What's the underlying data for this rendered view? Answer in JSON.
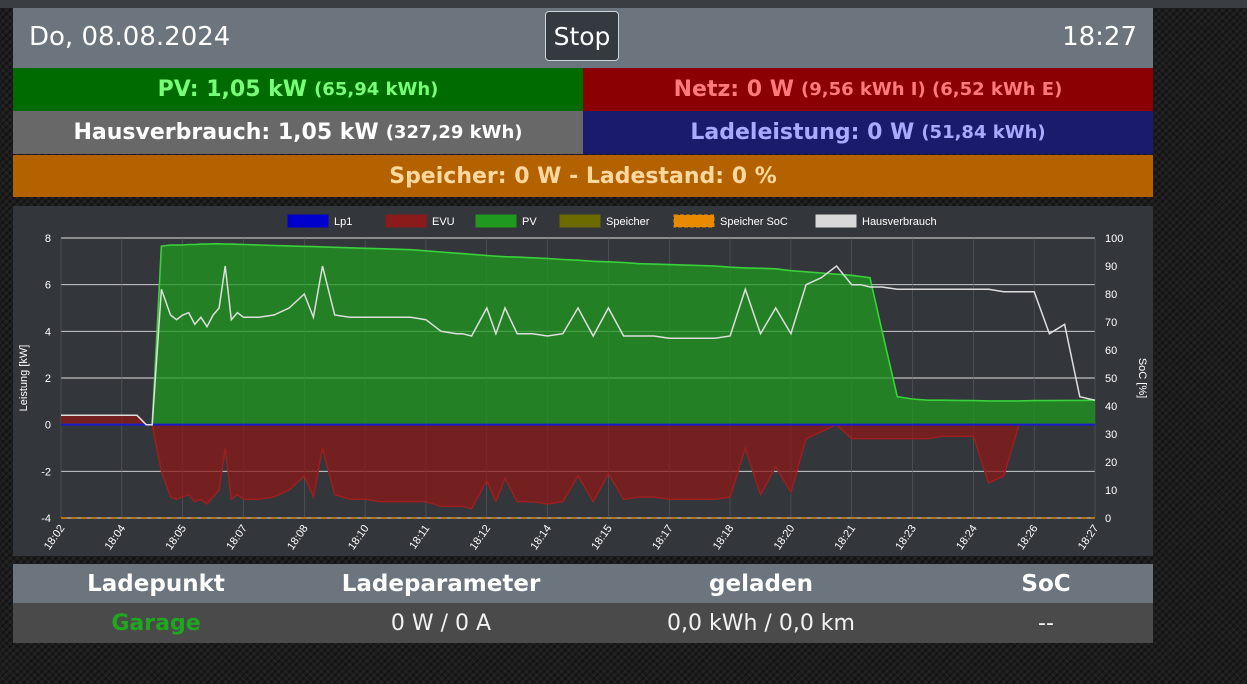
{
  "header": {
    "date": "Do, 08.08.2024",
    "stop_label": "Stop",
    "time": "18:27"
  },
  "status": {
    "pv_main": "PV: 1,05 kW",
    "pv_sub": "(65,94 kWh)",
    "netz_main": "Netz: 0 W",
    "netz_sub": "(9,56 kWh I) (6,52 kWh E)",
    "haus_main": "Hausverbrauch: 1,05 kW",
    "haus_sub": "(327,29 kWh)",
    "lade_main": "Ladeleistung: 0 W",
    "lade_sub": "(51,84 kWh)",
    "speicher": "Speicher: 0 W - Ladestand: 0 %"
  },
  "colors": {
    "pv_bg": "#006b00",
    "netz_bg": "#8b0000",
    "haus_bg": "#686868",
    "lade_bg": "#1b1b6e",
    "speicher_bg": "#b46200",
    "header_bg": "#6c757d"
  },
  "table": {
    "headers": [
      "Ladepunkt",
      "Ladeparameter",
      "geladen",
      "SoC"
    ],
    "row": [
      "Garage",
      "0 W / 0 A",
      "0,0 kWh / 0,0 km",
      "--"
    ]
  },
  "chart_data": {
    "type": "line",
    "ylabel": "Leistung [kW]",
    "y2label": "SoC [%]",
    "ylim": [
      -4,
      8
    ],
    "y2lim": [
      0,
      100
    ],
    "yticks": [
      8,
      6,
      4,
      2,
      0,
      -2,
      -4
    ],
    "y2ticks": [
      100,
      90,
      80,
      70,
      60,
      50,
      40,
      30,
      20,
      10,
      0
    ],
    "x_ticks": [
      "18:02",
      "18:04",
      "18:05",
      "18:07",
      "18:08",
      "18:10",
      "18:11",
      "18:12",
      "18:14",
      "18:15",
      "18:17",
      "18:18",
      "18:20",
      "18:21",
      "18:23",
      "18:24",
      "18:26",
      "18:27"
    ],
    "legend": [
      "Lp1",
      "EVU",
      "PV",
      "Speicher",
      "Speicher SoC",
      "Hausverbrauch"
    ],
    "legend_colors": [
      "#0000cc",
      "#8b1a1a",
      "#1f9a1f",
      "#6b6b00",
      "#e88b00",
      "#d8d8d8"
    ],
    "x": [
      0,
      0.6,
      1.2,
      1.8,
      2.1,
      2.5,
      2.8,
      3.0,
      3.3,
      3.6,
      3.8,
      4.0,
      4.2,
      4.4,
      4.6,
      4.8,
      5.0,
      5.2,
      5.4,
      5.6,
      5.8,
      6.0,
      6.5,
      7.0,
      7.5,
      8.0,
      8.3,
      8.6,
      9.0,
      9.5,
      10.0,
      10.5,
      11.0,
      11.5,
      12.0,
      12.5,
      13.0,
      13.2,
      13.5,
      14.0,
      14.3,
      14.6,
      15.0,
      15.5,
      16.0,
      16.5,
      17.0,
      17.5,
      18.0,
      18.5,
      19.0,
      19.5,
      20.0,
      20.5,
      21.0,
      21.5,
      22.0,
      22.5,
      23.0,
      23.5,
      24.0,
      24.5,
      25.0,
      25.5,
      26.0,
      26.3,
      26.6,
      27.0,
      27.5,
      28.0,
      28.5,
      29.0,
      29.5,
      30.0,
      30.5,
      31.0,
      31.5,
      32.0,
      32.5,
      33.0,
      33.5,
      34.0
    ],
    "pv": [
      0,
      0,
      0,
      0,
      0,
      0,
      0,
      0,
      7.65,
      7.7,
      7.7,
      7.7,
      7.72,
      7.72,
      7.74,
      7.74,
      7.75,
      7.75,
      7.74,
      7.74,
      7.73,
      7.72,
      7.7,
      7.68,
      7.66,
      7.64,
      7.63,
      7.62,
      7.6,
      7.58,
      7.56,
      7.54,
      7.52,
      7.5,
      7.45,
      7.4,
      7.35,
      7.33,
      7.3,
      7.25,
      7.22,
      7.2,
      7.18,
      7.15,
      7.12,
      7.08,
      7.05,
      7.0,
      6.98,
      6.95,
      6.9,
      6.88,
      6.86,
      6.84,
      6.82,
      6.8,
      6.75,
      6.72,
      6.7,
      6.68,
      6.6,
      6.55,
      6.5,
      6.45,
      6.4,
      6.35,
      6.3,
      4.0,
      1.2,
      1.1,
      1.05,
      1.05,
      1.04,
      1.03,
      1.02,
      1.02,
      1.02,
      1.03,
      1.03,
      1.04,
      1.04,
      1.05
    ],
    "haus": [
      0.4,
      0.4,
      0.4,
      0.4,
      0.4,
      0.4,
      0.0,
      0.0,
      5.8,
      4.7,
      4.5,
      4.7,
      4.8,
      4.3,
      4.6,
      4.2,
      4.7,
      5.0,
      6.8,
      4.5,
      4.8,
      4.6,
      4.6,
      4.7,
      5.0,
      5.6,
      4.6,
      6.8,
      4.7,
      4.6,
      4.6,
      4.6,
      4.6,
      4.6,
      4.5,
      4.0,
      3.9,
      3.9,
      3.8,
      5.0,
      3.9,
      5.0,
      3.9,
      3.9,
      3.8,
      3.9,
      5.0,
      3.8,
      5.0,
      3.8,
      3.8,
      3.8,
      3.7,
      3.7,
      3.7,
      3.7,
      3.8,
      5.8,
      3.9,
      5.0,
      3.9,
      6.0,
      6.3,
      6.8,
      6.0,
      6.0,
      5.9,
      5.9,
      5.8,
      5.8,
      5.8,
      5.8,
      5.8,
      5.8,
      5.8,
      5.7,
      5.7,
      5.7,
      3.9,
      4.3,
      1.2,
      1.05
    ],
    "evu": [
      0.4,
      0.4,
      0.4,
      0.4,
      0.4,
      0.4,
      0,
      0,
      -2.0,
      -3.1,
      -3.2,
      -3.1,
      -3.0,
      -3.3,
      -3.2,
      -3.4,
      -3.1,
      -2.8,
      -1.0,
      -3.2,
      -3.0,
      -3.2,
      -3.2,
      -3.1,
      -2.8,
      -2.2,
      -3.1,
      -1.0,
      -3.0,
      -3.2,
      -3.2,
      -3.3,
      -3.3,
      -3.3,
      -3.3,
      -3.5,
      -3.5,
      -3.5,
      -3.6,
      -2.4,
      -3.3,
      -2.3,
      -3.3,
      -3.3,
      -3.4,
      -3.3,
      -2.2,
      -3.3,
      -2.1,
      -3.2,
      -3.1,
      -3.1,
      -3.2,
      -3.2,
      -3.2,
      -3.2,
      -3.1,
      -1.0,
      -3.0,
      -1.8,
      -2.9,
      -0.6,
      -0.3,
      0,
      -0.6,
      -0.6,
      -0.6,
      -0.6,
      -0.6,
      -0.6,
      -0.6,
      -0.5,
      -0.5,
      -0.5,
      -2.5,
      -2.2,
      0,
      0,
      0,
      0,
      0,
      0
    ]
  }
}
